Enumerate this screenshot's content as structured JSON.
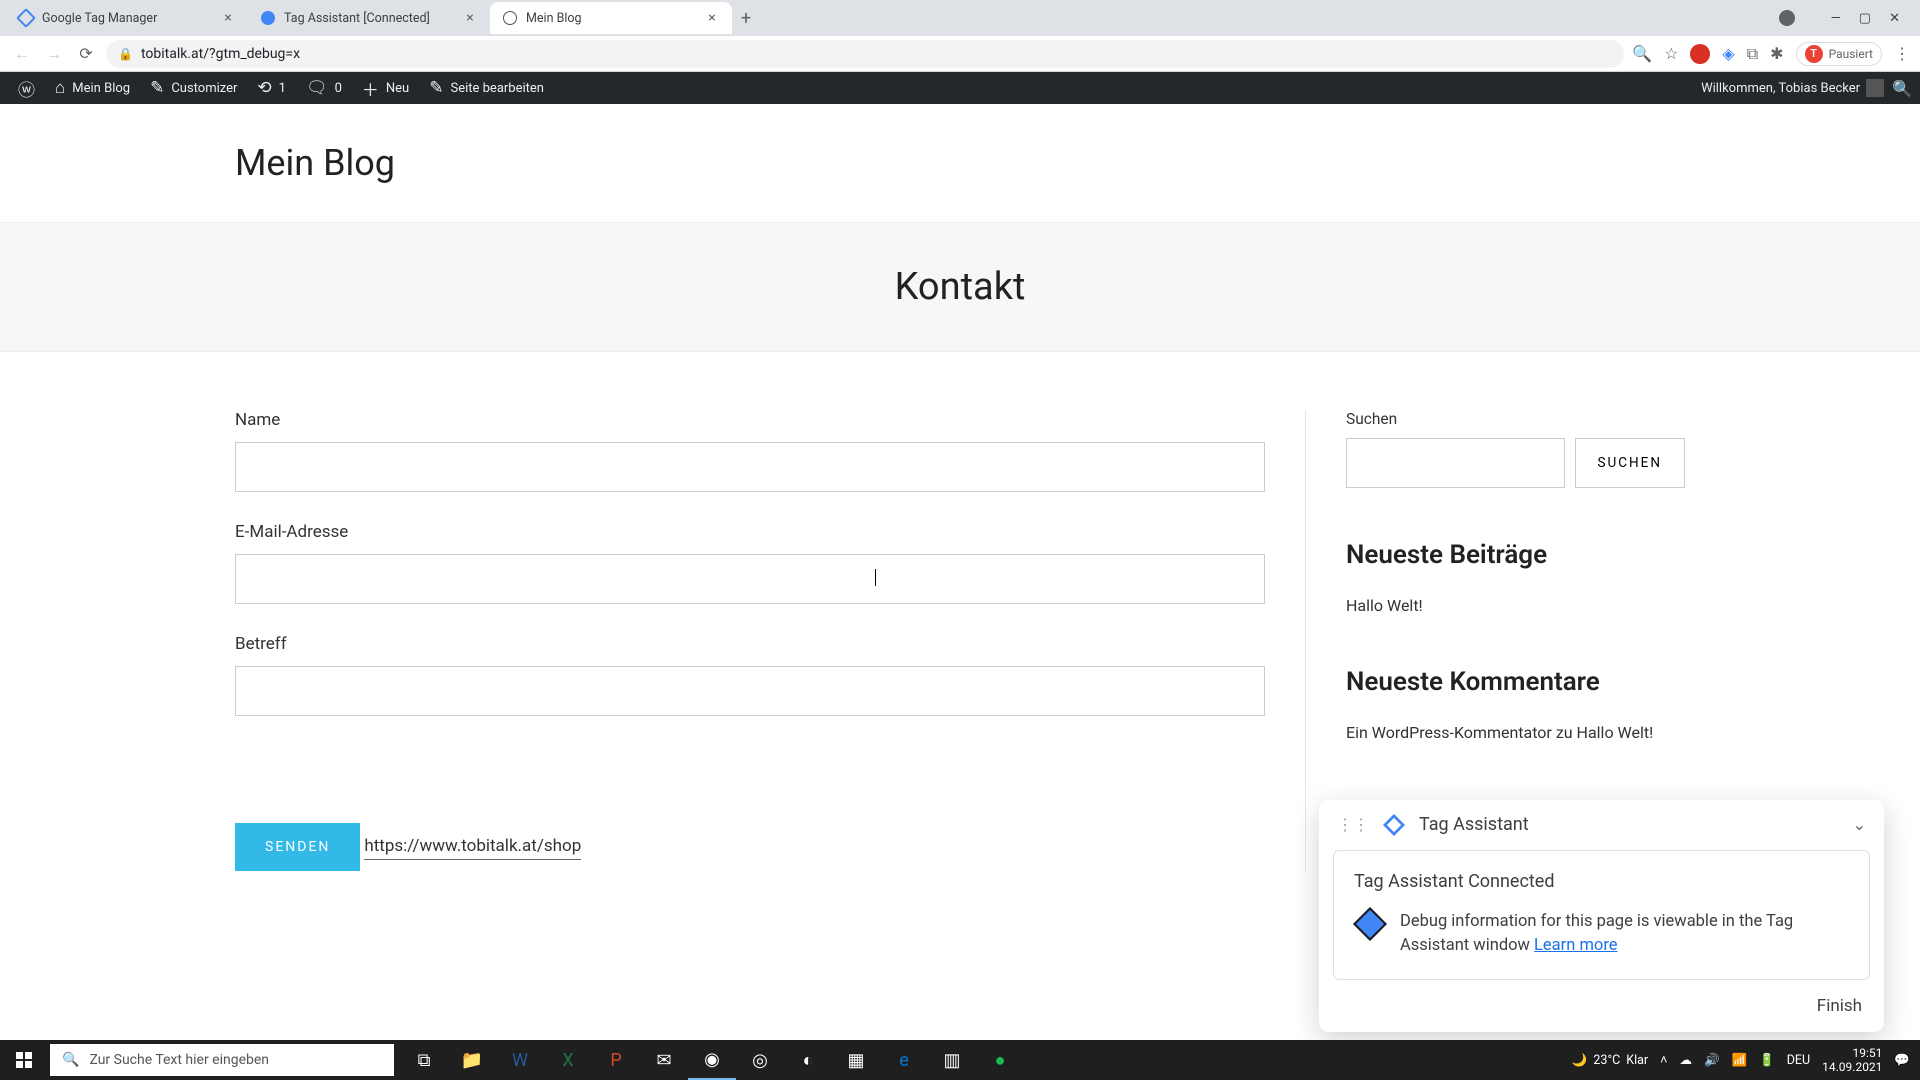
{
  "browser": {
    "tabs": [
      {
        "title": "Google Tag Manager"
      },
      {
        "title": "Tag Assistant [Connected]"
      },
      {
        "title": "Mein Blog"
      }
    ],
    "url": "tobitalk.at/?gtm_debug=x",
    "profile_state": "Pausiert",
    "profile_initial": "T"
  },
  "wp_bar": {
    "site": "Mein Blog",
    "customizer": "Customizer",
    "updates": "1",
    "comments": "0",
    "new": "Neu",
    "edit": "Seite bearbeiten",
    "welcome": "Willkommen, Tobias Becker"
  },
  "site": {
    "title": "Mein Blog",
    "page_title": "Kontakt"
  },
  "form": {
    "name_label": "Name",
    "email_label": "E-Mail-Adresse",
    "subject_label": "Betreff",
    "submit": "SENDEN",
    "name_value": "",
    "email_value": "",
    "subject_value": ""
  },
  "content_link": "https://www.tobitalk.at/shop",
  "sidebar": {
    "search_label": "Suchen",
    "search_btn": "SUCHEN",
    "recent_posts_title": "Neueste Beiträge",
    "recent_posts": [
      "Hallo Welt!"
    ],
    "recent_comments_title": "Neueste Kommentare",
    "recent_comments": [
      "Ein WordPress-Kommentator zu Hallo Welt!"
    ]
  },
  "tag_assistant": {
    "title": "Tag Assistant",
    "connected": "Tag Assistant Connected",
    "message": "Debug information for this page is viewable in the Tag Assistant window ",
    "learn_more": "Learn more",
    "finish": "Finish"
  },
  "taskbar": {
    "search_placeholder": "Zur Suche Text hier eingeben",
    "weather_temp": "23°C",
    "weather_desc": "Klar",
    "lang": "DEU",
    "time": "19:51",
    "date": "14.09.2021"
  }
}
